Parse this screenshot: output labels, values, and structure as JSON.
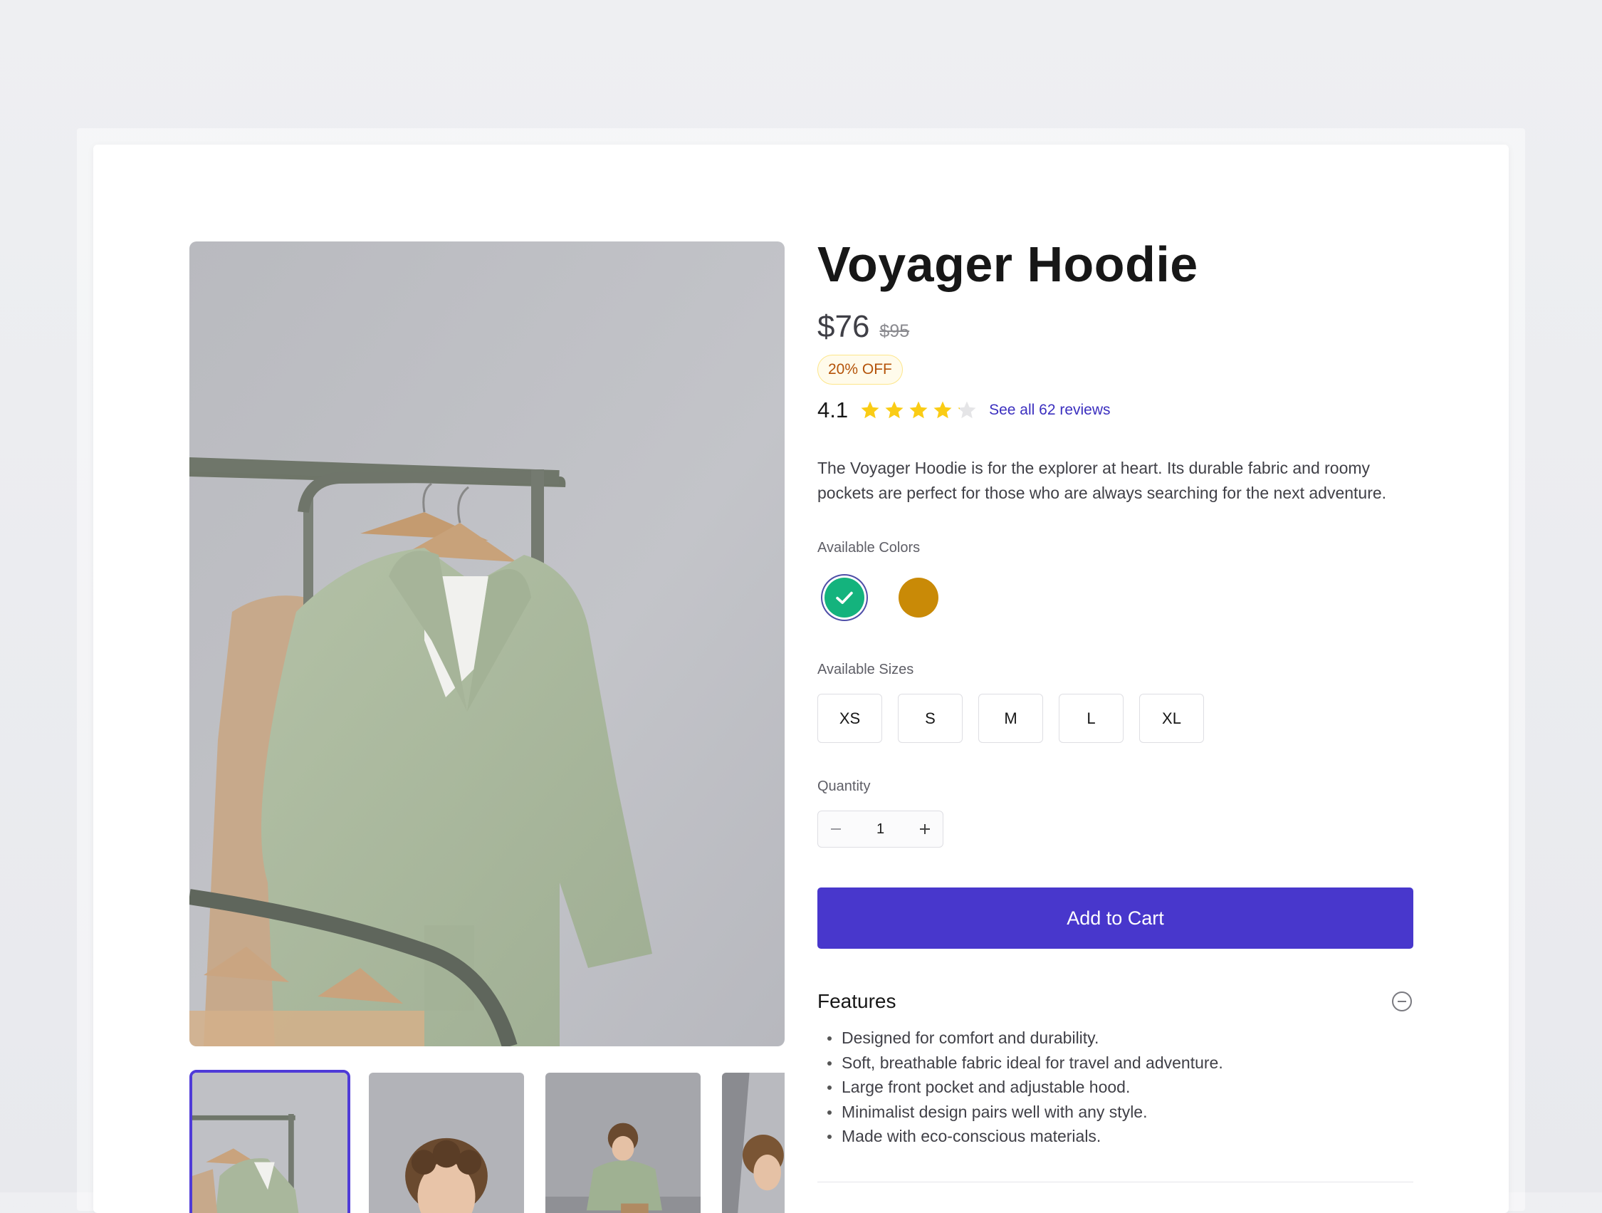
{
  "product": {
    "title": "Voyager Hoodie",
    "price": "$76",
    "original_price": "$95",
    "discount_badge": "20% OFF",
    "rating": "4.1",
    "rating_value": 4.1,
    "rating_max": 5,
    "reviews_link": "See all 62 reviews",
    "description": "The Voyager Hoodie is for the explorer at heart. Its durable fabric and roomy pockets are perfect for those who are always searching for the next adventure."
  },
  "colors": {
    "label": "Available Colors",
    "options": [
      {
        "name": "green",
        "hex": "#14b37d",
        "selected": true
      },
      {
        "name": "ochre",
        "hex": "#c98a07",
        "selected": false
      }
    ]
  },
  "sizes": {
    "label": "Available Sizes",
    "options": [
      "XS",
      "S",
      "M",
      "L",
      "XL"
    ]
  },
  "quantity": {
    "label": "Quantity",
    "value": "1",
    "decrement_icon": "minus-icon",
    "increment_icon": "plus-icon"
  },
  "cart": {
    "button_label": "Add to Cart"
  },
  "features": {
    "title": "Features",
    "toggle_icon": "collapse-minus-icon",
    "items": [
      "Designed for comfort and durability.",
      "Soft, breathable fabric ideal for travel and adventure.",
      "Large front pocket and adjustable hood.",
      "Minimalist design pairs well with any style.",
      "Made with eco-conscious materials."
    ]
  },
  "gallery": {
    "thumbnails": [
      {
        "name": "thumb-hoodie-rack",
        "active": true
      },
      {
        "name": "thumb-model-face",
        "active": false
      },
      {
        "name": "thumb-model-seated",
        "active": false
      },
      {
        "name": "thumb-model-side",
        "active": false
      }
    ]
  },
  "theme": {
    "accent": "#4837cc",
    "star": "#facc15",
    "badge_text": "#b45309",
    "badge_bg": "#fffbeb"
  }
}
